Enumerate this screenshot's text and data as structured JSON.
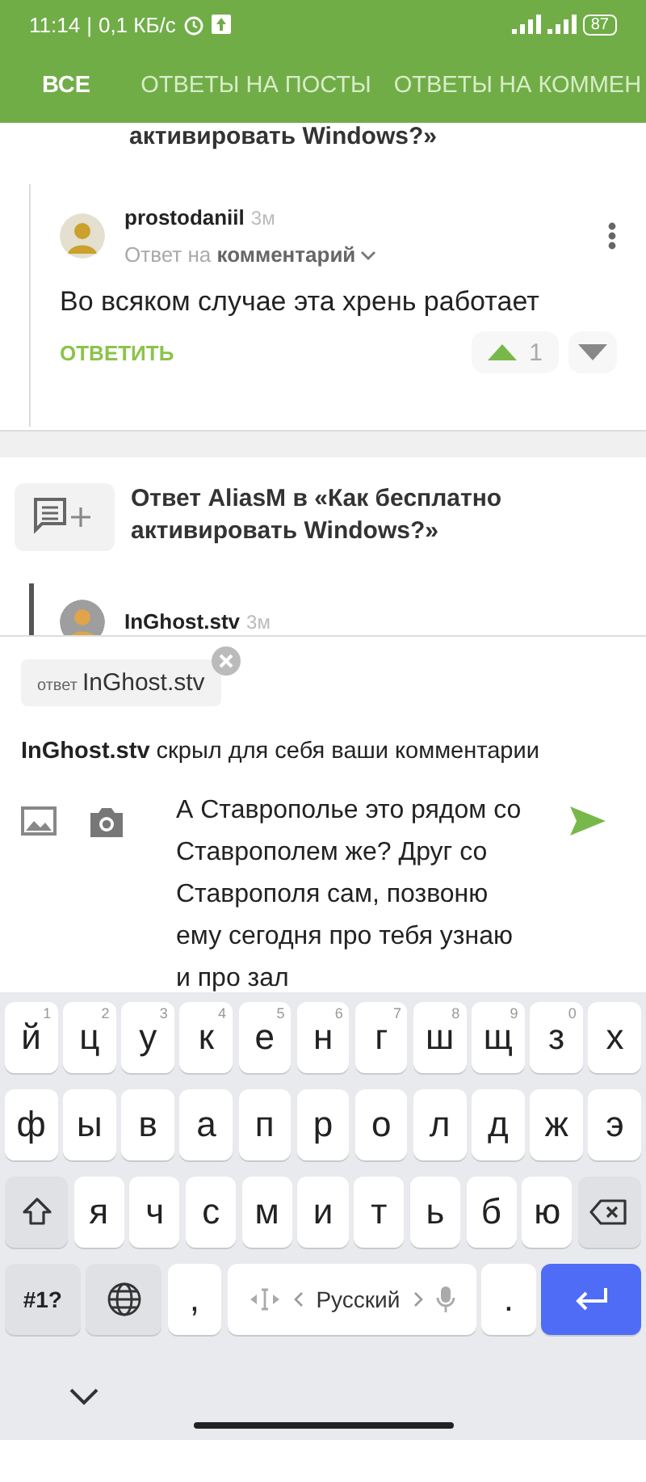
{
  "status_bar": {
    "time": "11:14",
    "separator": "|",
    "speed": "0,1 КБ/с",
    "battery": "87"
  },
  "tabs": [
    {
      "label": "ВСЕ",
      "selected": true
    },
    {
      "label": "ОТВЕТЫ НА ПОСТЫ",
      "selected": false
    },
    {
      "label": "ОТВЕТЫ НА КОММЕН",
      "selected": false
    }
  ],
  "previous_card": {
    "title_tail": "активировать Windows?»"
  },
  "comment": {
    "author": "prostodaniil",
    "age": "3м",
    "reply_prefix": "Ответ на",
    "reply_target": "комментарий",
    "text": "Во всяком случае эта хрень работает",
    "reply_action": "ОТВЕТИТЬ",
    "votes": "1"
  },
  "card": {
    "title": "Ответ AliasM в «Как бесплатно активировать Windows?»",
    "comment": {
      "author": "InGhost.stv",
      "age": "3м"
    }
  },
  "reply_chip": {
    "prefix": "ответ",
    "name": "InGhost.stv"
  },
  "notice": {
    "name": "InGhost.stv",
    "text": "скрыл для себя ваши комментарии"
  },
  "composer": {
    "value": "А Ставрополье это рядом со Ставрополем же? Друг со Ставрополя сам, позвоню ему сегодня про тебя узнаю и про зал"
  },
  "keyboard": {
    "language": "Русский",
    "rows": [
      [
        {
          "kind": "letter",
          "label": "й",
          "hint": "1"
        },
        {
          "kind": "letter",
          "label": "ц",
          "hint": "2"
        },
        {
          "kind": "letter",
          "label": "у",
          "hint": "3"
        },
        {
          "kind": "letter",
          "label": "к",
          "hint": "4"
        },
        {
          "kind": "letter",
          "label": "е",
          "hint": "5"
        },
        {
          "kind": "letter",
          "label": "н",
          "hint": "6"
        },
        {
          "kind": "letter",
          "label": "г",
          "hint": "7"
        },
        {
          "kind": "letter",
          "label": "ш",
          "hint": "8"
        },
        {
          "kind": "letter",
          "label": "щ",
          "hint": "9"
        },
        {
          "kind": "letter",
          "label": "з",
          "hint": "0"
        },
        {
          "kind": "letter",
          "label": "х"
        }
      ],
      [
        {
          "kind": "letter",
          "label": "ф"
        },
        {
          "kind": "letter",
          "label": "ы"
        },
        {
          "kind": "letter",
          "label": "в"
        },
        {
          "kind": "letter",
          "label": "а"
        },
        {
          "kind": "letter",
          "label": "п"
        },
        {
          "kind": "letter",
          "label": "р"
        },
        {
          "kind": "letter",
          "label": "о"
        },
        {
          "kind": "letter",
          "label": "л"
        },
        {
          "kind": "letter",
          "label": "д"
        },
        {
          "kind": "letter",
          "label": "ж"
        },
        {
          "kind": "letter",
          "label": "э"
        }
      ],
      [
        {
          "kind": "shift"
        },
        {
          "kind": "letter",
          "label": "я"
        },
        {
          "kind": "letter",
          "label": "ч"
        },
        {
          "kind": "letter",
          "label": "с"
        },
        {
          "kind": "letter",
          "label": "м"
        },
        {
          "kind": "letter",
          "label": "и"
        },
        {
          "kind": "letter",
          "label": "т"
        },
        {
          "kind": "letter",
          "label": "ь"
        },
        {
          "kind": "letter",
          "label": "б"
        },
        {
          "kind": "letter",
          "label": "ю"
        },
        {
          "kind": "backspace"
        }
      ],
      [
        {
          "kind": "symbols",
          "label": "#1?"
        },
        {
          "kind": "globe"
        },
        {
          "kind": "letter",
          "label": ","
        },
        {
          "kind": "space"
        },
        {
          "kind": "letter",
          "label": "."
        },
        {
          "kind": "enter"
        }
      ]
    ]
  }
}
